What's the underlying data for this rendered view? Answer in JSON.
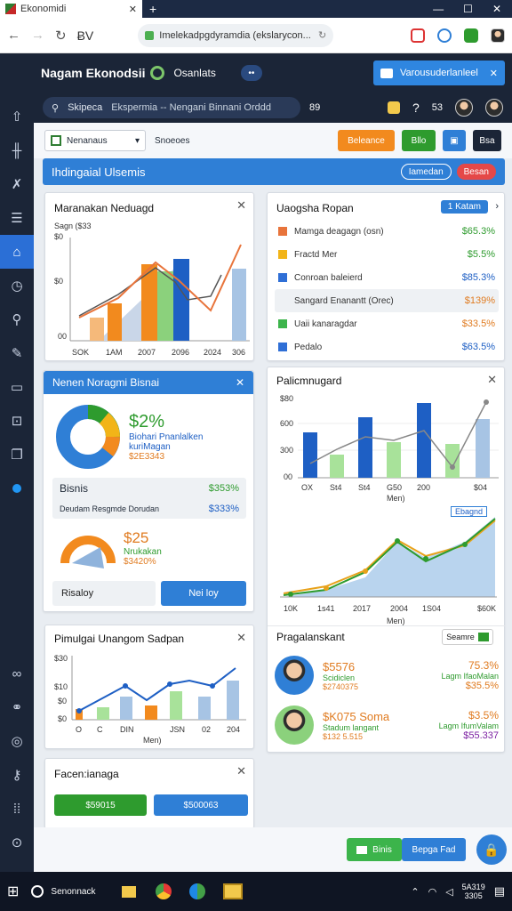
{
  "browser": {
    "tab_title": "Ekonomidi",
    "url": "Imelekadpgdyramdia (ekslarycon...",
    "profile_text": "ɃV"
  },
  "app": {
    "title": "Nagam Ekonodsii",
    "subtitle": "Osanlats",
    "notification": "Varousuderlanleel",
    "search_text": "Skipeca",
    "breadcrumb": "Ekspermia -- Nengani Binnani Orddd",
    "search_count": "89",
    "help_count": "53"
  },
  "toolbar": {
    "select_value": "Nenanaus",
    "filter_label": "Snoeoes",
    "btn_orange": "Beleance",
    "btn_green": "Bllo",
    "btn_dark": "Bsa"
  },
  "banner": {
    "title": "Ihdingaial Ulsemis",
    "btn1": "Iamedan",
    "btn2": "Besan"
  },
  "card_chart1": {
    "title": "Maranakan Neduagd",
    "legend": "Sagn ($33",
    "y_ticks": [
      "$0",
      "$0",
      "00"
    ],
    "x_ticks": [
      "SOK",
      "1AM",
      "2007",
      "2096",
      "2024",
      "306"
    ]
  },
  "card_list": {
    "title": "Uaogsha Ropan",
    "badge": "1 Katam",
    "items": [
      {
        "label": "Mamga deagagn (osn)",
        "value": "$65.3%",
        "color": "#e8743b",
        "value_color": "#2e9b2e"
      },
      {
        "label": "Fractd Mer",
        "value": "$5.5%",
        "color": "#f2b418",
        "value_color": "#2e9b2e"
      },
      {
        "label": "Conroan baleierd",
        "value": "$85.3%",
        "color": "#2f6fd6",
        "value_color": "#1e5fc4"
      },
      {
        "label": "Sangard Enanantt (Orec)",
        "value": "$139%",
        "color": "",
        "value_color": "#e07b20"
      },
      {
        "label": "Uaii kanaragdar",
        "value": "$33.5%",
        "color": "#3cb44b",
        "value_color": "#e07b20"
      },
      {
        "label": "Pedalo",
        "value": "$63.5%",
        "color": "#2f6fd6",
        "value_color": "#1e5fc4"
      }
    ]
  },
  "card_donut": {
    "title": "Nenen Noragmi Bisnai",
    "big_pct": "$2%",
    "line1": "Biohari Pnanlalken",
    "line2": "kuriMagan",
    "line3": "$2E3343",
    "row1_label": "Bisnis",
    "row1_value": "$353%",
    "row2_label": "Deudam Resgmde Dorudan",
    "row2_value": "$333%",
    "gauge_value": "$25",
    "gauge_label": "Nrukakan",
    "gauge_sub": "$3420%",
    "btn_left": "Risaloy",
    "btn_right": "Nei loy"
  },
  "card_chart2": {
    "title": "Palicmnugard",
    "y_ticks": [
      "$80",
      "600",
      "300",
      "00"
    ],
    "x_ticks": [
      "OX",
      "St4",
      "St4",
      "G50",
      "200",
      "$04"
    ],
    "x_label": "Men)"
  },
  "card_chart3": {
    "tag": "Ebagnd",
    "x_ticks": [
      "10K",
      "1s41",
      "2017",
      "2004",
      "1S04",
      "$60K"
    ],
    "x_label": "Men)"
  },
  "card_chart4": {
    "title": "Pimulgai Unangom Sadpan",
    "y_ticks": [
      "$30",
      "$10",
      "$0",
      "$0"
    ],
    "x_ticks": [
      "O",
      "C",
      "DIN",
      "JSN",
      "02",
      "204"
    ],
    "x_label": "Men)"
  },
  "card_people": {
    "title": "Pragalanskant",
    "btn": "Seamre",
    "people": [
      {
        "val1": "$5576",
        "val2": "$2740375",
        "line1": "Scidiclen",
        "pct1": "75.3%",
        "pct2": "Lagm IfaoMalan",
        "pct3": "$35.5%"
      },
      {
        "val1": "$K075 Soma",
        "val2": "$132 5.515",
        "line1": "Stadum langant",
        "pct1": "$3.5%",
        "pct2": "Lagm IfumValam",
        "pct3": "$55.337"
      }
    ]
  },
  "card_buttons": {
    "title": "Facen:ianaga",
    "btn1": "$59015",
    "btn2": "$500063"
  },
  "footer": {
    "btn1": "Binis",
    "btn2": "Bepga Fad"
  },
  "taskbar": {
    "search": "Senonnack",
    "time": "5A319",
    "date": "3305"
  },
  "chart_data": [
    {
      "type": "bar",
      "title": "Maranakan Neduagd",
      "categories": [
        "SOK",
        "1AM",
        "2007",
        "2096",
        "2024",
        "306"
      ],
      "series": [
        {
          "name": "bars",
          "values": [
            0.18,
            0.35,
            0.7,
            0.8,
            0.85,
            0.62
          ]
        },
        {
          "name": "line",
          "values": [
            0.25,
            0.35,
            0.62,
            0.78,
            0.45,
            0.85
          ]
        }
      ]
    },
    {
      "type": "bar",
      "title": "Palicmnugard",
      "categories": [
        "OX",
        "St4",
        "St4",
        "G50",
        "200",
        "$04"
      ],
      "series": [
        {
          "name": "blue",
          "values": [
            0.55,
            0.8,
            0.95,
            0.65,
            0.8,
            0.75
          ]
        },
        {
          "name": "green",
          "values": [
            0.3,
            0.45,
            0.45,
            0.45,
            0.45,
            0.75
          ]
        }
      ]
    },
    {
      "type": "area",
      "x": [
        "10K",
        "1s41",
        "2017",
        "2004",
        "1S04",
        "$60K"
      ],
      "series": [
        {
          "name": "area",
          "values": [
            0.05,
            0.15,
            0.3,
            0.62,
            0.45,
            0.98
          ]
        }
      ]
    },
    {
      "type": "bar",
      "title": "Pimulgai Unangom Sadpan",
      "categories": [
        "O",
        "C",
        "DIN",
        "JSN",
        "02",
        "204"
      ],
      "series": [
        {
          "name": "bars",
          "values": [
            0.2,
            0.25,
            0.45,
            0.55,
            0.5,
            0.75
          ]
        },
        {
          "name": "line",
          "values": [
            0.3,
            0.35,
            0.6,
            0.45,
            0.75,
            0.85
          ]
        }
      ]
    }
  ]
}
